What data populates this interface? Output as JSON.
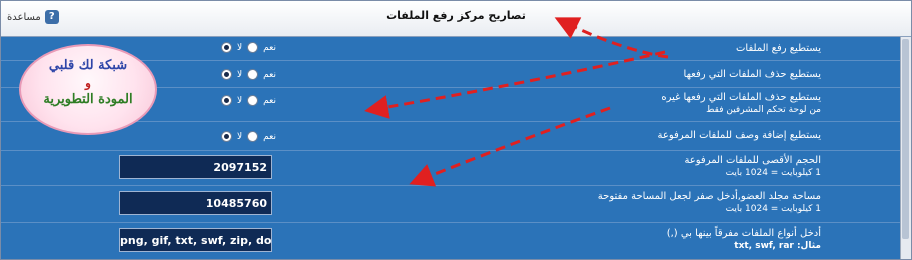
{
  "header": {
    "title": "تصاريح مركز رفع الملفات",
    "help_label": "مساعدة",
    "help_icon": "?"
  },
  "logo": {
    "line1": "شبكة لك قلبي",
    "and": "و",
    "line2": "المودة التطويرية"
  },
  "radio_labels": {
    "yes": "نعم",
    "no": "لا"
  },
  "permissions": [
    {
      "label": "يستطيع رفع الملفات",
      "sub": "",
      "selected": "no"
    },
    {
      "label": "يستطيع حذف الملفات التي رفعها",
      "sub": "",
      "selected": "no"
    },
    {
      "label": "يستطيع حذف الملفات التي رفعها غيره",
      "sub": "من لوحة تحكم المشرفين فقط",
      "selected": "no"
    },
    {
      "label": "يستطيع إضافة وصف للملفات المرفوعة",
      "sub": "",
      "selected": "no"
    }
  ],
  "fields": [
    {
      "label": "الحجم الأقصى للملفات المرفوعة",
      "sub": "1 كيلوبايت = 1024 بايت",
      "value": "2097152"
    },
    {
      "label": "مساحة مجلد العضو,أدخل صفر لجعل المساحة مفتوحة",
      "sub": "1 كيلوبايت = 1024 بايت",
      "value": "10485760"
    },
    {
      "label": "أدخل أنواع الملفات مفرقاً بينها بي (,)",
      "sub": "مثال: txt, swf, rar",
      "value": "png, gif, txt, swf, zip, doc"
    }
  ],
  "colors": {
    "panel": "#2b73b8",
    "field": "#0f2a55",
    "arrow": "#e02020"
  }
}
